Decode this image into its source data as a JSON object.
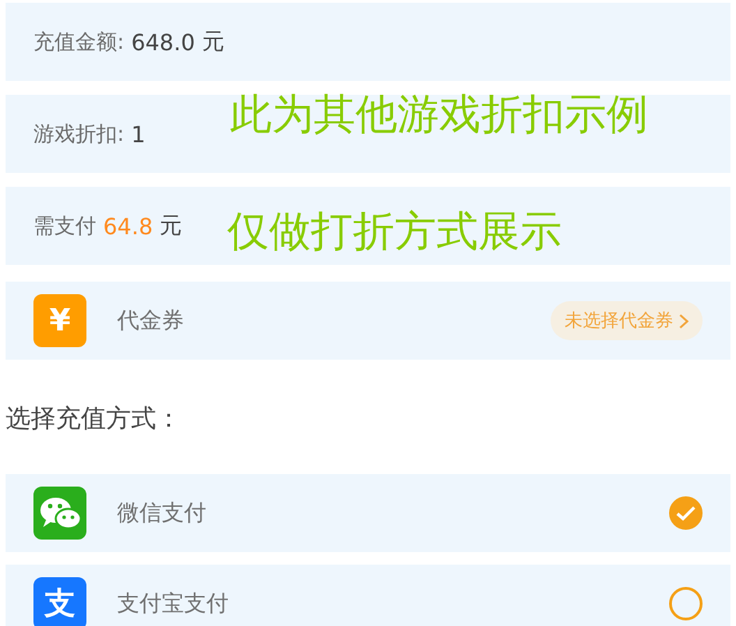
{
  "summary": [
    {
      "kind": "plain",
      "label": "充值金额:",
      "value": "648.0",
      "unit": "元"
    },
    {
      "kind": "plain",
      "label": "游戏折扣:",
      "value": "1"
    },
    {
      "kind": "highlight",
      "label": "需支付",
      "value": "64.8",
      "unit": "元"
    }
  ],
  "annotations": [
    "此为其他游戏折扣示例",
    "仅做打折方式展示"
  ],
  "voucher": {
    "icon_glyph": "¥",
    "label": "代金券",
    "status": "未选择代金券"
  },
  "payment_heading": "选择充值方式：",
  "payment_methods": [
    {
      "kind": "wechat",
      "label": "微信支付",
      "selected": true
    },
    {
      "kind": "alipay",
      "icon_glyph": "支",
      "label": "支付宝支付",
      "selected": false
    }
  ]
}
